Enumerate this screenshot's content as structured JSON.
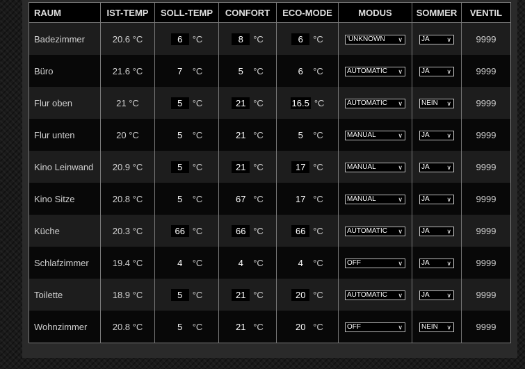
{
  "headers": [
    "RAUM",
    "IST-TEMP",
    "SOLL-TEMP",
    "CONFORT",
    "ECO-MODE",
    "MODUS",
    "SOMMER",
    "VENTIL"
  ],
  "unit": "°C",
  "rows": [
    {
      "room": "Badezimmer",
      "ist": "20.6 °C",
      "soll": "6",
      "confort": "8",
      "eco": "6",
      "modus": "'UNKNOWN",
      "sommer": "JA",
      "ventil": "9999"
    },
    {
      "room": "Büro",
      "ist": "21.6 °C",
      "soll": "7",
      "confort": "5",
      "eco": "6",
      "modus": "AUTOMATIC",
      "sommer": "JA",
      "ventil": "9999"
    },
    {
      "room": "Flur oben",
      "ist": "21 °C",
      "soll": "5",
      "confort": "21",
      "eco": "16.5",
      "modus": "AUTOMATIC",
      "sommer": "NEIN",
      "ventil": "9999"
    },
    {
      "room": "Flur unten",
      "ist": "20 °C",
      "soll": "5",
      "confort": "21",
      "eco": "5",
      "modus": "MANUAL",
      "sommer": "JA",
      "ventil": "9999"
    },
    {
      "room": "Kino Leinwand",
      "ist": "20.9 °C",
      "soll": "5",
      "confort": "21",
      "eco": "17",
      "modus": "MANUAL",
      "sommer": "JA",
      "ventil": "9999"
    },
    {
      "room": "Kino Sitze",
      "ist": "20.8 °C",
      "soll": "5",
      "confort": "67",
      "eco": "17",
      "modus": "MANUAL",
      "sommer": "JA",
      "ventil": "9999"
    },
    {
      "room": "Küche",
      "ist": "20.3 °C",
      "soll": "66",
      "confort": "66",
      "eco": "66",
      "modus": "AUTOMATIC",
      "sommer": "JA",
      "ventil": "9999"
    },
    {
      "room": "Schlafzimmer",
      "ist": "19.4 °C",
      "soll": "4",
      "confort": "4",
      "eco": "4",
      "modus": "OFF",
      "sommer": "JA",
      "ventil": "9999"
    },
    {
      "room": "Toilette",
      "ist": "18.9 °C",
      "soll": "5",
      "confort": "21",
      "eco": "20",
      "modus": "AUTOMATIC",
      "sommer": "JA",
      "ventil": "9999"
    },
    {
      "room": "Wohnzimmer",
      "ist": "20.8 °C",
      "soll": "5",
      "confort": "21",
      "eco": "20",
      "modus": "OFF",
      "sommer": "NEIN",
      "ventil": "9999"
    }
  ]
}
